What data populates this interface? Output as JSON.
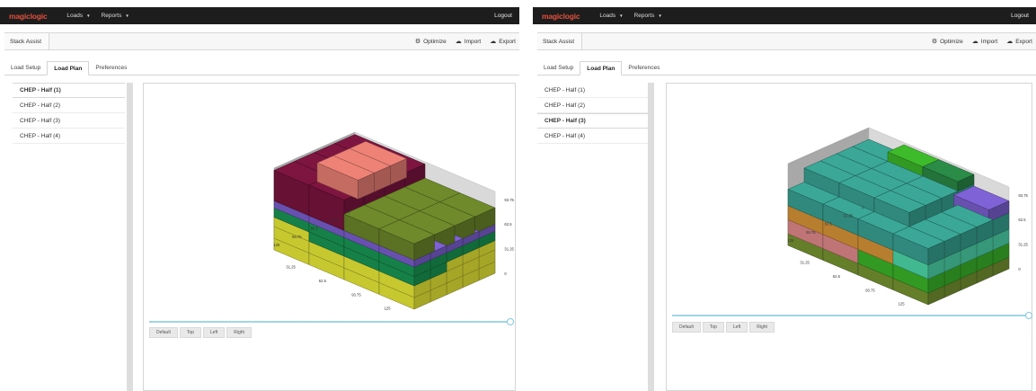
{
  "panels": [
    {
      "brand": "magiclogic",
      "nav": {
        "loads": "Loads",
        "reports": "Reports",
        "logout": "Logout"
      },
      "toolbar": {
        "title": "Stack Assist",
        "optimize": "Optimize",
        "import": "Import",
        "export": "Export"
      },
      "tabs": [
        "Load Setup",
        "Load Plan",
        "Preferences"
      ],
      "active_tab": "Load Plan",
      "loads": [
        "CHEP - Half (1)",
        "CHEP - Half (2)",
        "CHEP - Half (3)",
        "CHEP - Half (4)"
      ],
      "selected_load": "CHEP - Half (1)",
      "view_buttons": [
        "Default",
        "Top",
        "Left",
        "Right"
      ],
      "axis_right": [
        "93.75",
        "62.5",
        "31.25",
        "0"
      ],
      "axis_left": [
        "0",
        "31.25",
        "62.5",
        "93.75",
        "125"
      ],
      "axis_front": [
        "31.25",
        "62.5",
        "93.75",
        "125"
      ]
    },
    {
      "brand": "magiclogic",
      "nav": {
        "loads": "Loads",
        "reports": "Reports",
        "logout": "Logout"
      },
      "toolbar": {
        "title": "Stack Assist",
        "optimize": "Optimize",
        "import": "Import",
        "export": "Export"
      },
      "tabs": [
        "Load Setup",
        "Load Plan",
        "Preferences"
      ],
      "active_tab": "Load Plan",
      "loads": [
        "CHEP - Half (1)",
        "CHEP - Half (2)",
        "CHEP - Half (3)",
        "CHEP - Half (4)"
      ],
      "selected_load": "CHEP - Half (3)",
      "view_buttons": [
        "Default",
        "Top",
        "Left",
        "Right"
      ],
      "axis_right": [
        "93.75",
        "62.5",
        "31.25",
        "0"
      ],
      "axis_left": [
        "0",
        "31.25",
        "62.5",
        "93.75",
        "125"
      ],
      "axis_front": [
        "31.25",
        "62.5",
        "93.75",
        "125"
      ]
    }
  ],
  "icons": {
    "optimize": "cogs-icon",
    "import": "cloud-download-icon",
    "export": "cloud-upload-icon",
    "dropdown": "caret-down-icon"
  },
  "colors": {
    "navbar": "#1d1d1d",
    "brand": "#e2513c",
    "slider": "#9fd6ea",
    "panel_1_boxes": {
      "maroon": "#7d1540",
      "salmon": "#ef8277",
      "olive": "#6f8a2b",
      "purple": "#7f62d6",
      "green": "#1a9c57",
      "yellow": "#f3f33b"
    },
    "panel_2_boxes": {
      "teal": "#3aa797",
      "green": "#3dbb2b",
      "dark_green": "#2b8c48",
      "purple": "#7f62d6",
      "orange": "#e09a3a",
      "pink": "#e98f8f",
      "olive": "#7a9a33",
      "mint": "#4fe0b0"
    }
  }
}
